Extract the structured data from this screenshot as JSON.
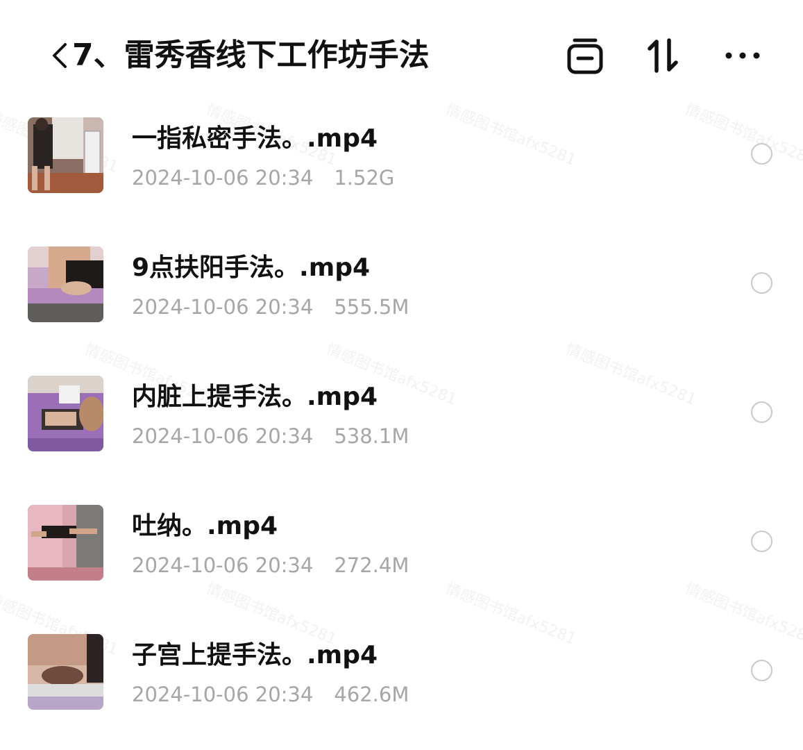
{
  "header": {
    "back_icon": "chevron-left-icon",
    "title": "7、雷秀香线下工作坊手法",
    "actions": [
      {
        "name": "select-box-icon"
      },
      {
        "name": "sort-icon"
      },
      {
        "name": "more-icon"
      }
    ]
  },
  "files": [
    {
      "name": "一指私密手法。.mp4",
      "date": "2024-10-06 20:34",
      "size": "1.52G"
    },
    {
      "name": "9点扶阳手法。.mp4",
      "date": "2024-10-06 20:34",
      "size": "555.5M"
    },
    {
      "name": "内脏上提手法。.mp4",
      "date": "2024-10-06 20:34",
      "size": "538.1M"
    },
    {
      "name": "吐纳。.mp4",
      "date": "2024-10-06 20:34",
      "size": "272.4M"
    },
    {
      "name": "子宫上提手法。.mp4",
      "date": "2024-10-06 20:34",
      "size": "462.6M"
    }
  ],
  "watermark": "情感图书馆afx5281",
  "colors": {
    "text": "#111111",
    "meta": "#a6a6a6",
    "radio": "#c9c9c9"
  }
}
